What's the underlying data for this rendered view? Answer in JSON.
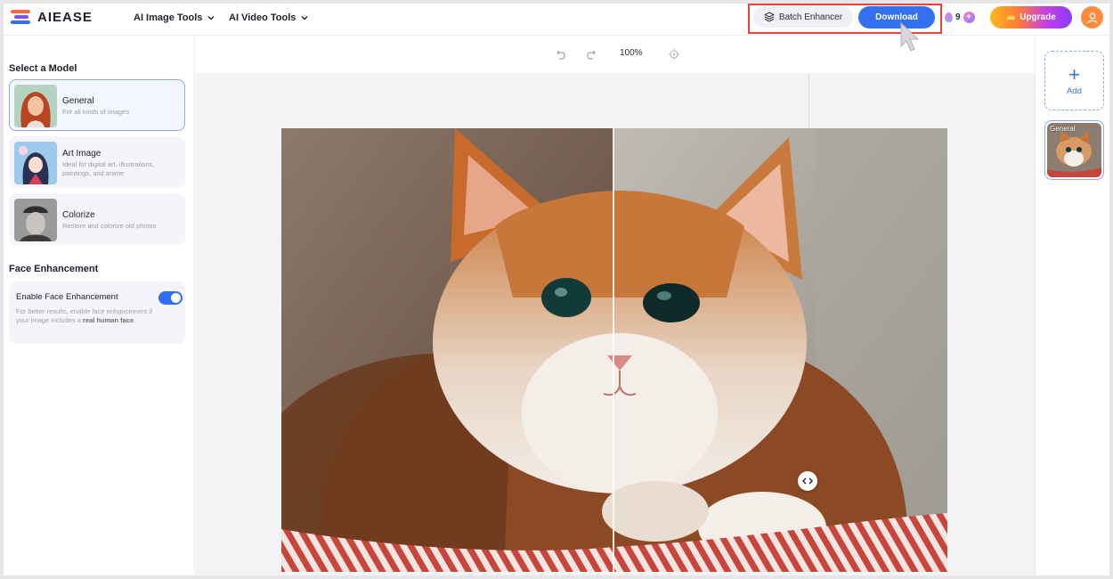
{
  "header": {
    "logo_text": "AIEASE",
    "nav": [
      {
        "label": "AI Image Tools"
      },
      {
        "label": "AI Video Tools"
      }
    ],
    "batch_label": "Batch Enhancer",
    "download_label": "Download",
    "credits": "9",
    "upgrade_label": "Upgrade"
  },
  "left": {
    "select_model_title": "Select a Model",
    "models": [
      {
        "name": "General",
        "desc": "For all kinds of images",
        "selected": true
      },
      {
        "name": "Art Image",
        "desc": "Ideal for digital art, illustrations, paintings, and anime",
        "selected": false
      },
      {
        "name": "Colorize",
        "desc": "Restore and colorize old photos",
        "selected": false
      }
    ],
    "face_title": "Face Enhancement",
    "face_toggle_label": "Enable Face Enhancement",
    "face_desc_pre": "For better results, enable face enhancement if your image includes a ",
    "face_desc_bold": "real human face",
    "face_desc_post": ".",
    "face_enabled": true
  },
  "toolbar": {
    "zoom": "100%"
  },
  "right": {
    "add_label": "Add",
    "thumb_tag": "General"
  },
  "colors": {
    "accent": "#3370f0",
    "highlight": "#e8443a"
  }
}
